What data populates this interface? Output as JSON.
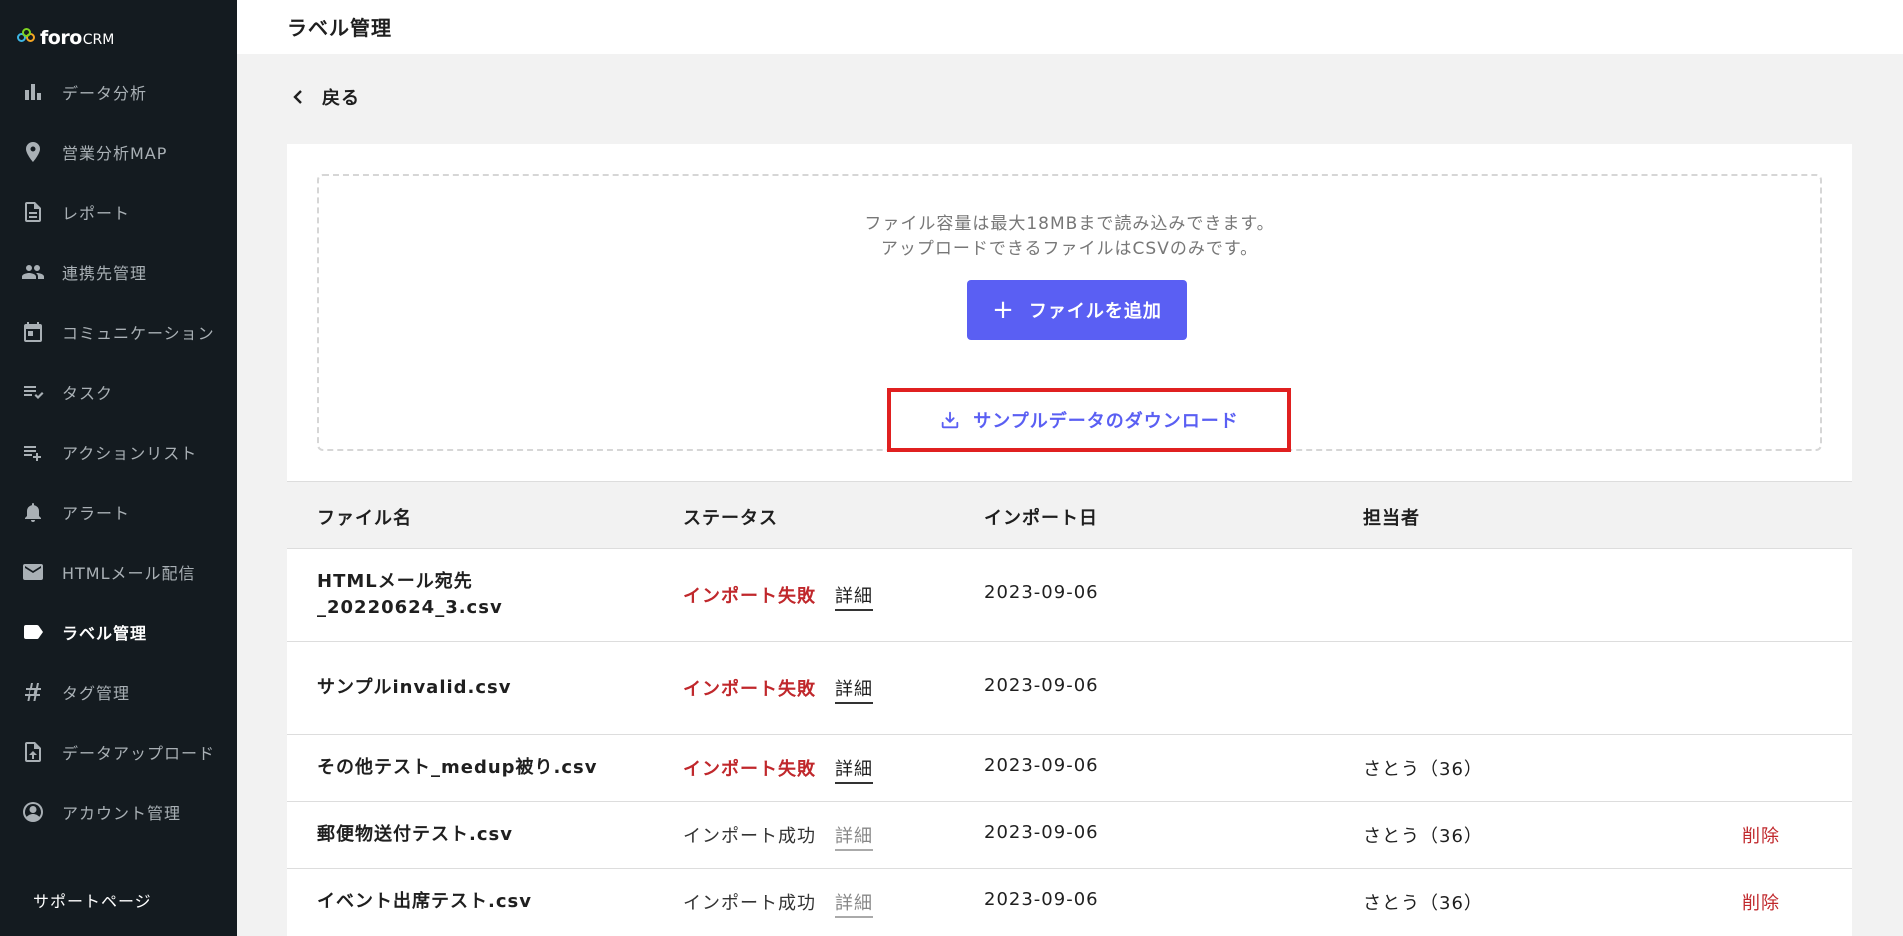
{
  "brand": {
    "name": "foro",
    "suffix": "CRM"
  },
  "sidebar": {
    "items": [
      {
        "label": "データ分析",
        "icon": "bar-chart-icon"
      },
      {
        "label": "営業分析MAP",
        "icon": "map-pin-icon"
      },
      {
        "label": "レポート",
        "icon": "document-icon"
      },
      {
        "label": "連携先管理",
        "icon": "people-icon"
      },
      {
        "label": "コミュニケーション",
        "icon": "calendar-icon"
      },
      {
        "label": "タスク",
        "icon": "checklist-icon"
      },
      {
        "label": "アクションリスト",
        "icon": "playlist-add-icon"
      },
      {
        "label": "アラート",
        "icon": "bell-icon"
      },
      {
        "label": "HTMLメール配信",
        "icon": "mail-icon"
      },
      {
        "label": "ラベル管理",
        "icon": "label-icon",
        "active": true
      },
      {
        "label": "タグ管理",
        "icon": "hash-icon"
      },
      {
        "label": "データアップロード",
        "icon": "upload-file-icon"
      },
      {
        "label": "アカウント管理",
        "icon": "account-circle-icon"
      }
    ],
    "support": "サポートページ"
  },
  "header": {
    "title": "ラベル管理"
  },
  "back": {
    "label": "戻る"
  },
  "upload": {
    "info_line1": "ファイル容量は最大18MBまで読み込みできます。",
    "info_line2": "アップロードできるファイルはCSVのみです。",
    "add_button": "ファイルを追加",
    "download_link": "サンプルデータのダウンロード"
  },
  "table": {
    "headers": {
      "file": "ファイル名",
      "status": "ステータス",
      "date": "インポート日",
      "owner": "担当者"
    },
    "detail_label": "詳細",
    "delete_label": "削除",
    "rows": [
      {
        "file": "HTMLメール宛先_20220624_3.csv",
        "status": "インポート失敗",
        "date": "2023-09-06",
        "owner": ""
      },
      {
        "file": "サンプルinvalid.csv",
        "status": "インポート失敗",
        "date": "2023-09-06",
        "owner": ""
      },
      {
        "file": "その他テスト_medup被り.csv",
        "status": "インポート失敗",
        "date": "2023-09-06",
        "owner": "さとう（36）"
      },
      {
        "file": "郵便物送付テスト.csv",
        "status": "インポート成功",
        "date": "2023-09-06",
        "owner": "さとう（36）"
      },
      {
        "file": "イベント出席テスト.csv",
        "status": "インポート成功",
        "date": "2023-09-06",
        "owner": "さとう（36）"
      }
    ]
  },
  "colors": {
    "sidebar_bg": "#141b20",
    "accent": "#5a5ff3",
    "error": "#c0282c",
    "highlight": "#e02020"
  }
}
